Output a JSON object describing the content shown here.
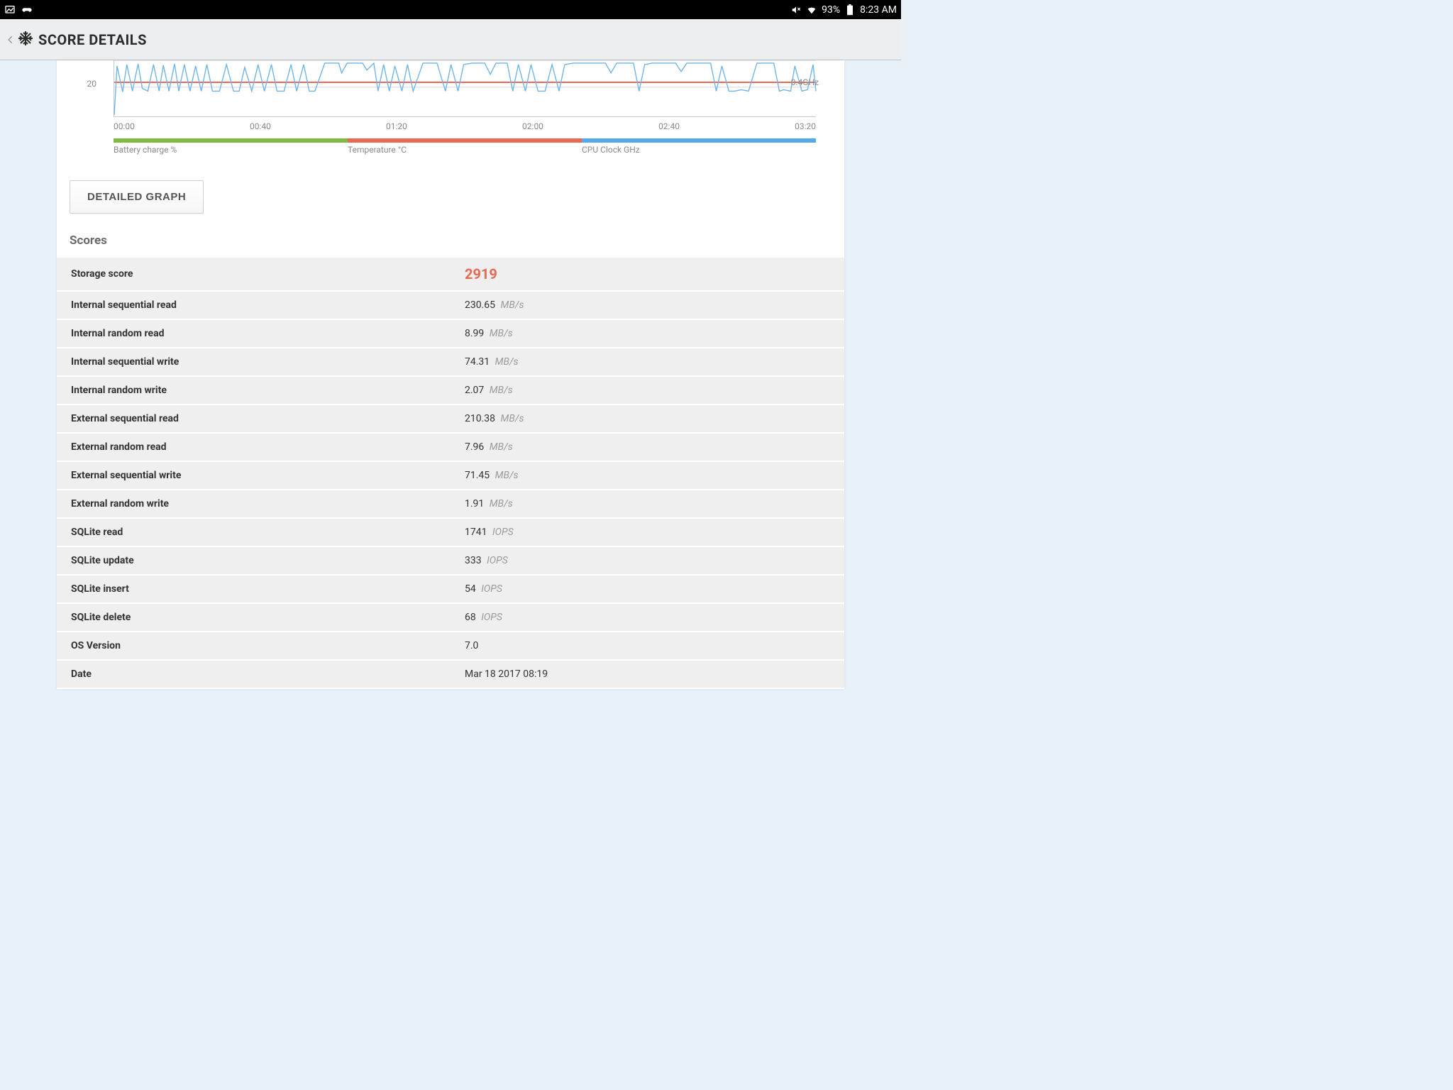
{
  "status": {
    "battery_pct": "93%",
    "time": "8:23 AM"
  },
  "header": {
    "title": "SCORE DETAILS"
  },
  "chart_data": {
    "type": "line",
    "title": "",
    "x_ticks": [
      "00:00",
      "00:40",
      "01:20",
      "02:00",
      "02:40",
      "03:20"
    ],
    "y_left_tick": "20",
    "y_right_tick": "0.4GHz",
    "xlabel": "",
    "ylabel": "",
    "series": [
      {
        "name": "Battery charge %",
        "color": "#7fbb3f"
      },
      {
        "name": "Temperature °C",
        "color": "#e86a55",
        "approx_value": 30
      },
      {
        "name": "CPU Clock GHz",
        "color": "#56a9e6",
        "approx_range": [
          0.2,
          0.9
        ]
      }
    ],
    "legend": {
      "battery": "Battery charge %",
      "temp": "Temperature °C",
      "cpu": "CPU Clock GHz"
    }
  },
  "buttons": {
    "detailed_graph": "DETAILED GRAPH"
  },
  "sections": {
    "scores_heading": "Scores"
  },
  "scores": [
    {
      "label": "Storage score",
      "value": "2919",
      "unit": "",
      "highlight": true
    },
    {
      "label": "Internal sequential read",
      "value": "230.65",
      "unit": "MB/s"
    },
    {
      "label": "Internal random read",
      "value": "8.99",
      "unit": "MB/s"
    },
    {
      "label": "Internal sequential write",
      "value": "74.31",
      "unit": "MB/s"
    },
    {
      "label": "Internal random write",
      "value": "2.07",
      "unit": "MB/s"
    },
    {
      "label": "External sequential read",
      "value": "210.38",
      "unit": "MB/s"
    },
    {
      "label": "External random read",
      "value": "7.96",
      "unit": "MB/s"
    },
    {
      "label": "External sequential write",
      "value": "71.45",
      "unit": "MB/s"
    },
    {
      "label": "External random write",
      "value": "1.91",
      "unit": "MB/s"
    },
    {
      "label": "SQLite read",
      "value": "1741",
      "unit": "IOPS"
    },
    {
      "label": "SQLite update",
      "value": "333",
      "unit": "IOPS"
    },
    {
      "label": "SQLite insert",
      "value": "54",
      "unit": "IOPS"
    },
    {
      "label": "SQLite delete",
      "value": "68",
      "unit": "IOPS"
    },
    {
      "label": "OS Version",
      "value": "7.0",
      "unit": ""
    },
    {
      "label": "Date",
      "value": "Mar 18 2017 08:19",
      "unit": ""
    }
  ]
}
